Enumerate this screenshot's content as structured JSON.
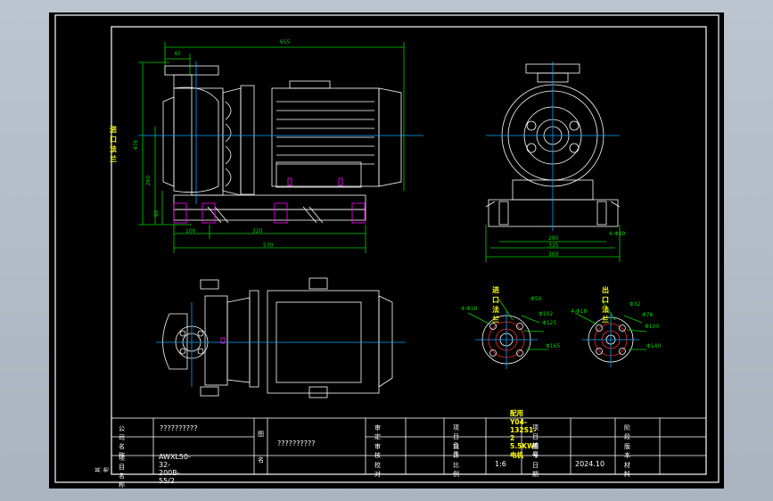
{
  "drawing": {
    "dimensions": {
      "overall_length": "655",
      "nozzle_offset": "40",
      "height_left": "476",
      "shaft_height": "260",
      "foot_height": "90",
      "foot_a": "100",
      "foot_b": "320",
      "base_length": "570",
      "side_width_1": "280",
      "side_width_2": "335",
      "side_width_3": "360",
      "bolt_hole": "4-Φ19"
    },
    "labels": {
      "inlet_flange_side": "进口法兰",
      "inlet_flange": "进口法兰",
      "outlet_flange": "出口法兰",
      "motor_note": "配用Y04-132S1-2  5.5KW电机"
    },
    "inlet_flange": {
      "bolt": "4-Φ18",
      "d1": "Φ50",
      "d2": "Φ102",
      "d3": "Φ125",
      "d4": "Φ165"
    },
    "outlet_flange": {
      "bolt": "4-Φ18",
      "d1": "Φ32",
      "d2": "Φ76",
      "d3": "Φ100",
      "d4": "Φ140"
    }
  },
  "title_block": {
    "company_label": "公司名称",
    "company_value": "??????????",
    "project_label": "项目名称",
    "project_value": "AWXL50-32-200B-55/2",
    "figure_label_1": "图",
    "figure_label_2": "名",
    "figure_value": "??????????",
    "left_note": "其他",
    "rows": [
      [
        "审  定",
        "",
        "项目负责",
        "",
        "项目编号",
        "",
        "阶  段",
        ""
      ],
      [
        "审  核",
        "",
        "设  计",
        "",
        "图  号",
        "",
        "版  本",
        ""
      ],
      [
        "校  对",
        "",
        "比  例",
        "1:6",
        "日  期",
        "2024.10",
        "材  料",
        ""
      ]
    ]
  },
  "colors": {
    "frame": "#ffffff",
    "dimension": "#00d200",
    "centerline": "#00a6ff",
    "label": "#ffff00",
    "flange_red": "#ff2a2a",
    "foot_magenta": "#ff00ff"
  }
}
